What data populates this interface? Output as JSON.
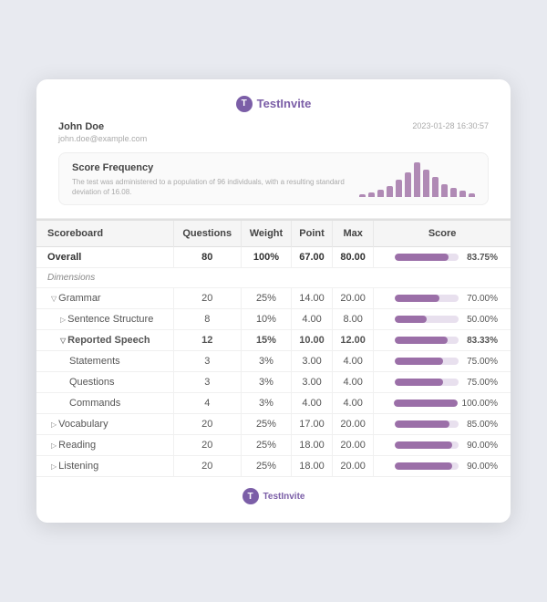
{
  "logo": {
    "icon": "T",
    "name": "TestInvite"
  },
  "user": {
    "name": "John Doe",
    "email": "john.doe@example.com",
    "date": "2023-01-28 16:30:57"
  },
  "scoreFrequency": {
    "title": "Score Frequency",
    "desc": "The test was administered to a population of 96 individuals, with a resulting standard deviation of 16.08.",
    "bars": [
      2,
      4,
      6,
      9,
      14,
      20,
      28,
      22,
      16,
      10,
      7,
      5,
      3
    ]
  },
  "table": {
    "headers": [
      "Scoreboard",
      "Questions",
      "Weight",
      "Point",
      "Max",
      "Score"
    ],
    "rows": [
      {
        "type": "overall",
        "label": "Overall",
        "questions": 80,
        "weight": "100%",
        "point": "67.00",
        "max": "80.00",
        "pct": 83.75,
        "pctLabel": "83.75%"
      },
      {
        "type": "dimensions",
        "label": "Dimensions"
      },
      {
        "type": "grammar",
        "label": "Grammar",
        "questions": 20,
        "weight": "25%",
        "point": "14.00",
        "max": "20.00",
        "pct": 70,
        "pctLabel": "70.00%",
        "expanded": true
      },
      {
        "type": "sub",
        "label": "Sentence Structure",
        "questions": 8,
        "weight": "10%",
        "point": "4.00",
        "max": "8.00",
        "pct": 50,
        "pctLabel": "50.00%"
      },
      {
        "type": "reported",
        "label": "Reported Speech",
        "questions": 12,
        "weight": "15%",
        "point": "10.00",
        "max": "12.00",
        "pct": 83.33,
        "pctLabel": "83.33%",
        "expanded": true
      },
      {
        "type": "sub2",
        "label": "Statements",
        "questions": 3,
        "weight": "3%",
        "point": "3.00",
        "max": "4.00",
        "pct": 75,
        "pctLabel": "75.00%"
      },
      {
        "type": "sub2",
        "label": "Questions",
        "questions": 3,
        "weight": "3%",
        "point": "3.00",
        "max": "4.00",
        "pct": 75,
        "pctLabel": "75.00%"
      },
      {
        "type": "sub2",
        "label": "Commands",
        "questions": 4,
        "weight": "3%",
        "point": "4.00",
        "max": "4.00",
        "pct": 100,
        "pctLabel": "100.00%"
      },
      {
        "type": "vocab",
        "label": "Vocabulary",
        "questions": 20,
        "weight": "25%",
        "point": "17.00",
        "max": "20.00",
        "pct": 85,
        "pctLabel": "85.00%"
      },
      {
        "type": "reading",
        "label": "Reading",
        "questions": 20,
        "weight": "25%",
        "point": "18.00",
        "max": "20.00",
        "pct": 90,
        "pctLabel": "90.00%"
      },
      {
        "type": "listening",
        "label": "Listening",
        "questions": 20,
        "weight": "25%",
        "point": "18.00",
        "max": "20.00",
        "pct": 90,
        "pctLabel": "90.00%"
      }
    ]
  }
}
